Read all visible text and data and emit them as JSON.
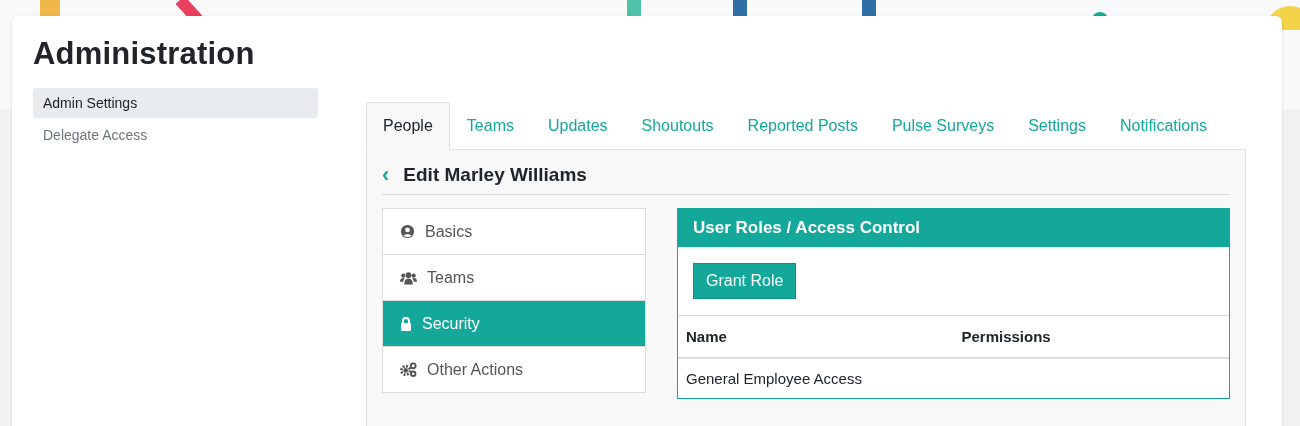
{
  "page": {
    "title": "Administration"
  },
  "sidebar": {
    "items": [
      {
        "label": "Admin Settings",
        "selected": true
      },
      {
        "label": "Delegate Access",
        "selected": false
      }
    ]
  },
  "tabs": [
    {
      "label": "People",
      "selected": true
    },
    {
      "label": "Teams",
      "selected": false
    },
    {
      "label": "Updates",
      "selected": false
    },
    {
      "label": "Shoutouts",
      "selected": false
    },
    {
      "label": "Reported Posts",
      "selected": false
    },
    {
      "label": "Pulse Surveys",
      "selected": false
    },
    {
      "label": "Settings",
      "selected": false
    },
    {
      "label": "Notifications",
      "selected": false
    }
  ],
  "editor": {
    "back": "‹",
    "title": "Edit Marley Williams",
    "menu": [
      {
        "label": "Basics",
        "kind": "user",
        "selected": false
      },
      {
        "label": "Teams",
        "kind": "group",
        "selected": false
      },
      {
        "label": "Security",
        "kind": "lock",
        "selected": true
      },
      {
        "label": "Other Actions",
        "kind": "gears",
        "selected": false
      }
    ],
    "panel": {
      "title": "User Roles / Access Control",
      "button": "Grant Role",
      "table": {
        "columns": [
          "Name",
          "Permissions"
        ],
        "rows": [
          [
            "General Employee Access",
            ""
          ]
        ]
      }
    }
  }
}
